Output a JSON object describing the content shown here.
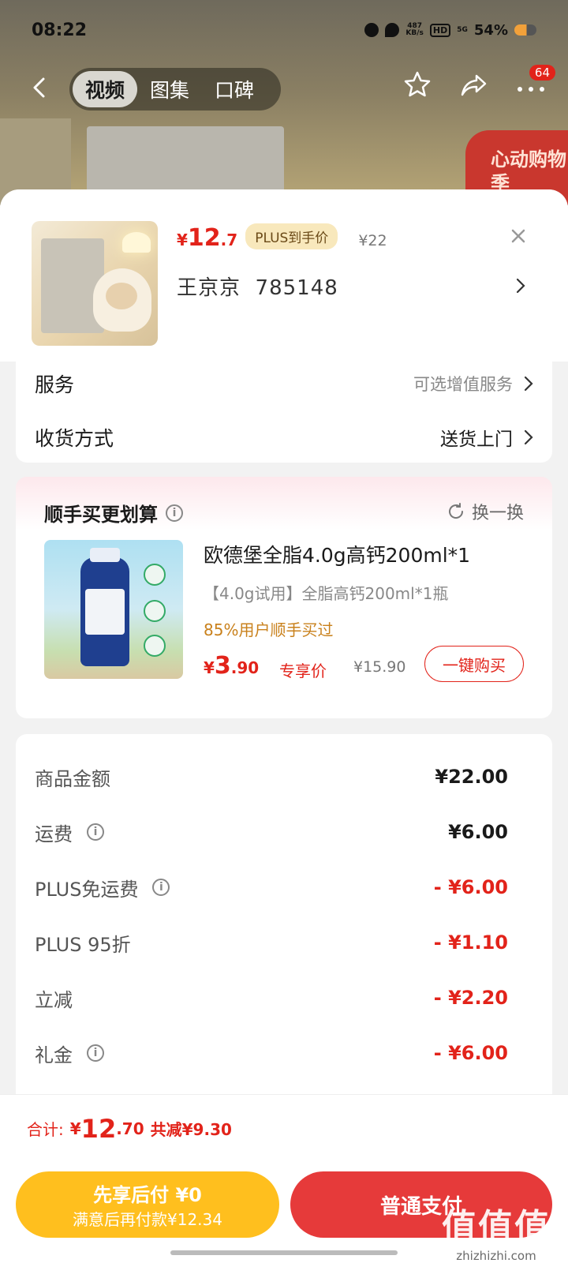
{
  "status_bar": {
    "time": "08:22",
    "net_speed": "487",
    "net_unit": "KB/s",
    "hd": "HD",
    "signal": "5G",
    "battery": "54%"
  },
  "nav": {
    "tabs": [
      "视频",
      "图集",
      "口碑"
    ],
    "active_tab": 0,
    "badge": "64"
  },
  "background": {
    "promo": "心动购物季"
  },
  "sku": {
    "price_symbol": "¥",
    "price_int": "12",
    "price_dec": ".7",
    "plus_tag": "PLUS到手价",
    "orig_price": "¥22",
    "spec_name": "王京京",
    "spec_code": "785148"
  },
  "options": {
    "service_label": "服务",
    "service_value": "可选增值服务",
    "delivery_label": "收货方式",
    "delivery_value": "送货上门"
  },
  "bundle": {
    "title": "顺手买更划算",
    "swap_label": "换一换",
    "name": "欧德堡全脂4.0g高钙200ml*1",
    "subtitle": "【4.0g试用】全脂高钙200ml*1瓶",
    "bought_pct": "85%用户顺手买过",
    "price_symbol": "¥",
    "price_int": "3",
    "price_dec": ".90",
    "exclusive": "专享价",
    "orig_price": "¥15.90",
    "buy_btn": "一键购买"
  },
  "fees": [
    {
      "label": "商品金额",
      "amount": "¥22.00",
      "info": false,
      "discount": false
    },
    {
      "label": "运费",
      "amount": "¥6.00",
      "info": true,
      "discount": false
    },
    {
      "label": "PLUS免运费",
      "amount": "- ¥6.00",
      "info": true,
      "discount": true
    },
    {
      "label": "PLUS 95折",
      "amount": "- ¥1.10",
      "info": false,
      "discount": true
    },
    {
      "label": "立减",
      "amount": "- ¥2.20",
      "info": false,
      "discount": true
    },
    {
      "label": "礼金",
      "amount": "- ¥6.00",
      "info": true,
      "discount": true
    }
  ],
  "total": {
    "label": "合计:",
    "symbol": "¥",
    "int": "12",
    "dec": ".70",
    "saved": "共减¥9.30"
  },
  "buttons": {
    "pay_later_title": "先享后付 ¥0",
    "pay_later_sub": "满意后再付款¥12.34",
    "pay_normal": "普通支付"
  },
  "watermark": {
    "logo": "值值值",
    "site": "zhizhizhi.com"
  },
  "colors": {
    "accent": "#e2231a",
    "gold": "#ffbf1e",
    "pay": "#e63a3a"
  }
}
